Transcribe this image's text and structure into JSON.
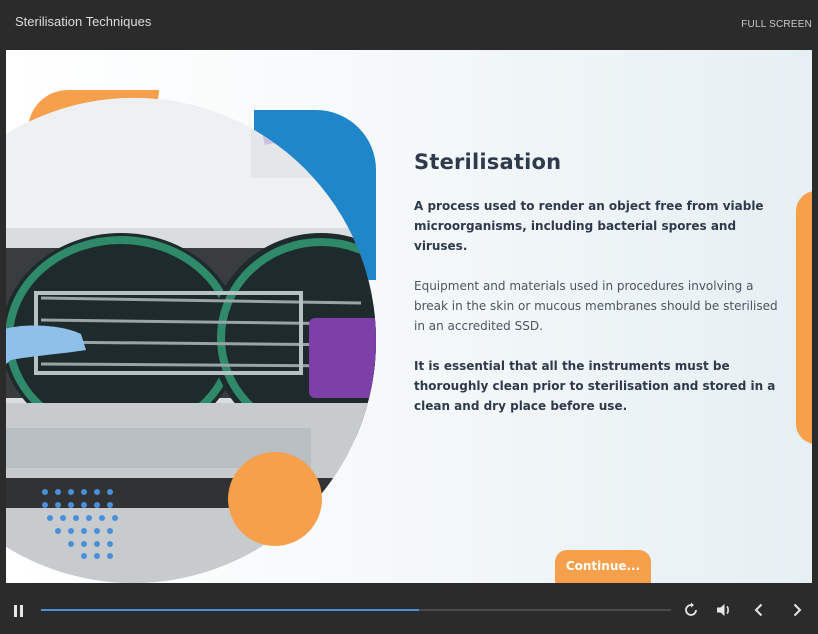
{
  "header": {
    "title": "Sterilisation Techniques",
    "fullscreen_label": "FULL SCREEN"
  },
  "slide": {
    "heading": "Sterilisation",
    "paragraphs": [
      "A process used to render an object free from viable microorganisms, including bacterial spores and viruses.",
      "Equipment and materials used in procedures involving a break in the skin or mucous membranes should be sterilised in an accredited SSD.",
      "It is essential that all the instruments must be thoroughly clean prior to sterilisation and stored in a clean and dry place before use."
    ],
    "continue_label": "Continue..."
  },
  "player": {
    "progress": 0.6,
    "icons": [
      "pause-icon",
      "replay-icon",
      "volume-icon",
      "previous-icon",
      "next-icon"
    ]
  },
  "colors": {
    "accent_orange": "#f7a04b",
    "accent_blue": "#1e86c9",
    "heading": "#2e3a4b",
    "bar": "#2b2b2b"
  }
}
